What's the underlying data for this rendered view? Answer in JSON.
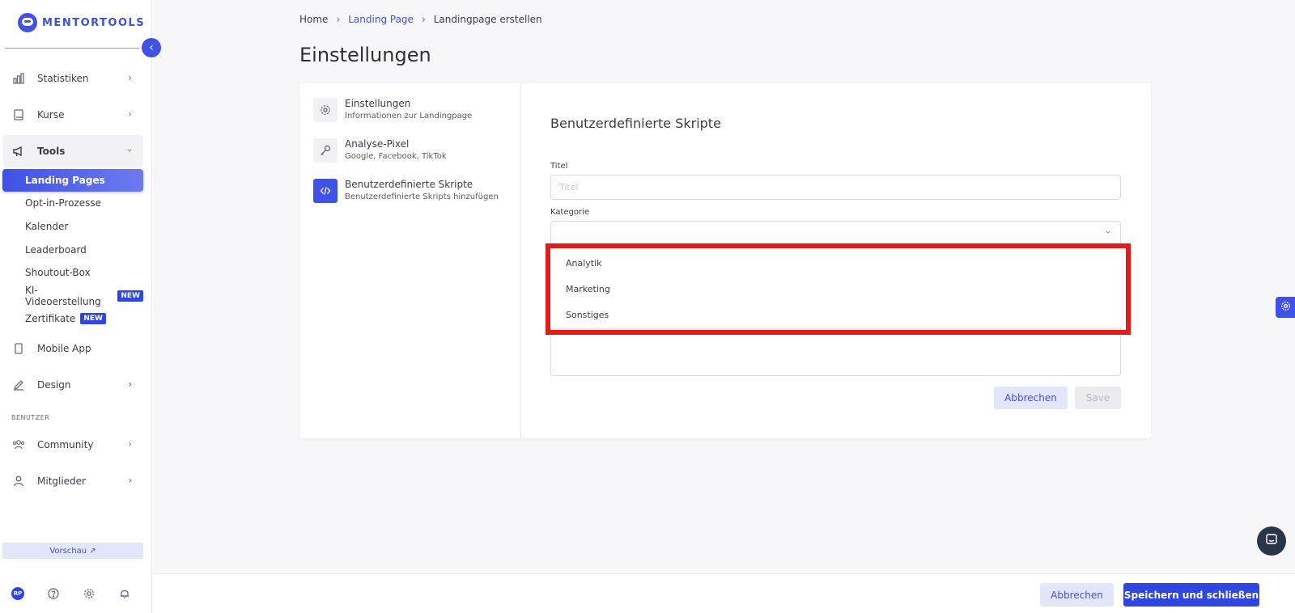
{
  "brand": {
    "name": "MENTORTOOLS"
  },
  "sidebar": {
    "nav": [
      {
        "label": "Statistiken",
        "icon": "bar-chart-icon"
      },
      {
        "label": "Kurse",
        "icon": "book-icon"
      },
      {
        "label": "Tools",
        "icon": "megaphone-icon"
      },
      {
        "label": "Mobile App",
        "icon": "phone-icon"
      },
      {
        "label": "Design",
        "icon": "pencil-icon"
      },
      {
        "label": "Community",
        "icon": "people-icon"
      },
      {
        "label": "Mitglieder",
        "icon": "user-icon"
      }
    ],
    "tools_sub": [
      {
        "label": "Landing Pages"
      },
      {
        "label": "Opt-in-Prozesse"
      },
      {
        "label": "Kalender"
      },
      {
        "label": "Leaderboard"
      },
      {
        "label": "Shoutout-Box"
      },
      {
        "label": "KI-Videoerstellung",
        "badge": "NEW"
      },
      {
        "label": "Zertifikate",
        "badge": "NEW"
      }
    ],
    "section_users": "BENUTZER",
    "preview": "Vorschau ↗",
    "avatar": "RP"
  },
  "breadcrumb": {
    "home": "Home",
    "landing": "Landing Page",
    "current": "Landingpage erstellen"
  },
  "page_title": "Einstellungen",
  "settings_menu": [
    {
      "title": "Einstellungen",
      "subtitle": "Informationen zur Landingpage"
    },
    {
      "title": "Analyse-Pixel",
      "subtitle": "Google, Facebook, TikTok"
    },
    {
      "title": "Benutzerdefinierte Skripte",
      "subtitle": "Benutzerdefinierte Skripts hinzufügen"
    }
  ],
  "form": {
    "section_title": "Benutzerdefinierte Skripte",
    "title_label": "Titel",
    "title_placeholder": "Titel",
    "title_value": "",
    "category_label": "Kategorie",
    "category_value": "",
    "category_options": [
      "Analytik",
      "Marketing",
      "Sonstiges"
    ],
    "cancel": "Abbrechen",
    "save": "Save"
  },
  "footer": {
    "cancel": "Abbrechen",
    "save_close": "Speichern und schließen"
  },
  "colors": {
    "accent": "#3f51e6",
    "highlight": "#e31b1b"
  }
}
